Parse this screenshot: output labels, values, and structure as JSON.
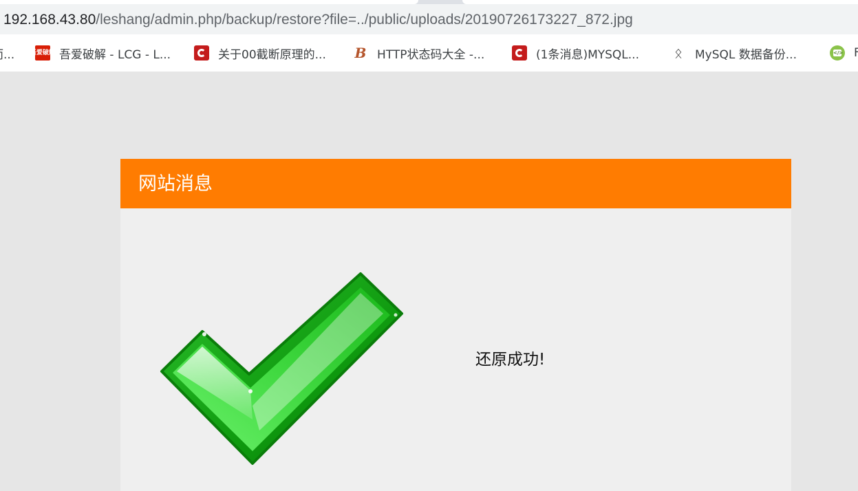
{
  "address_bar": {
    "url_host": "192.168.43.80",
    "url_path": "/leshang/admin.php/backup/restore?file=../public/uploads/20190726173227_872.jpg"
  },
  "bookmarks": [
    {
      "label": "而...",
      "icon": "truncated-icon"
    },
    {
      "label": "吾爱破解 - LCG - L...",
      "icon": "52pojie-icon",
      "icon_text": "吾爱破解"
    },
    {
      "label": "关于00截断原理的...",
      "icon": "csdn-icon"
    },
    {
      "label": "HTTP状态码大全 -...",
      "icon": "b-logo-icon",
      "icon_text": "B"
    },
    {
      "label": "(1条消息)MYSQL...",
      "icon": "csdn-icon"
    },
    {
      "label": "MySQL 数据备份...",
      "icon": "mysql-dolphin-icon"
    },
    {
      "label": "F",
      "icon": "code-icon"
    }
  ],
  "message": {
    "title": "网站消息",
    "text": "还原成功!",
    "status_icon": "success-check-icon"
  },
  "colors": {
    "header_orange": "#ff7c01",
    "check_green": "#1aa51a",
    "page_bg": "#e6e6e6",
    "box_bg": "#efefef"
  }
}
